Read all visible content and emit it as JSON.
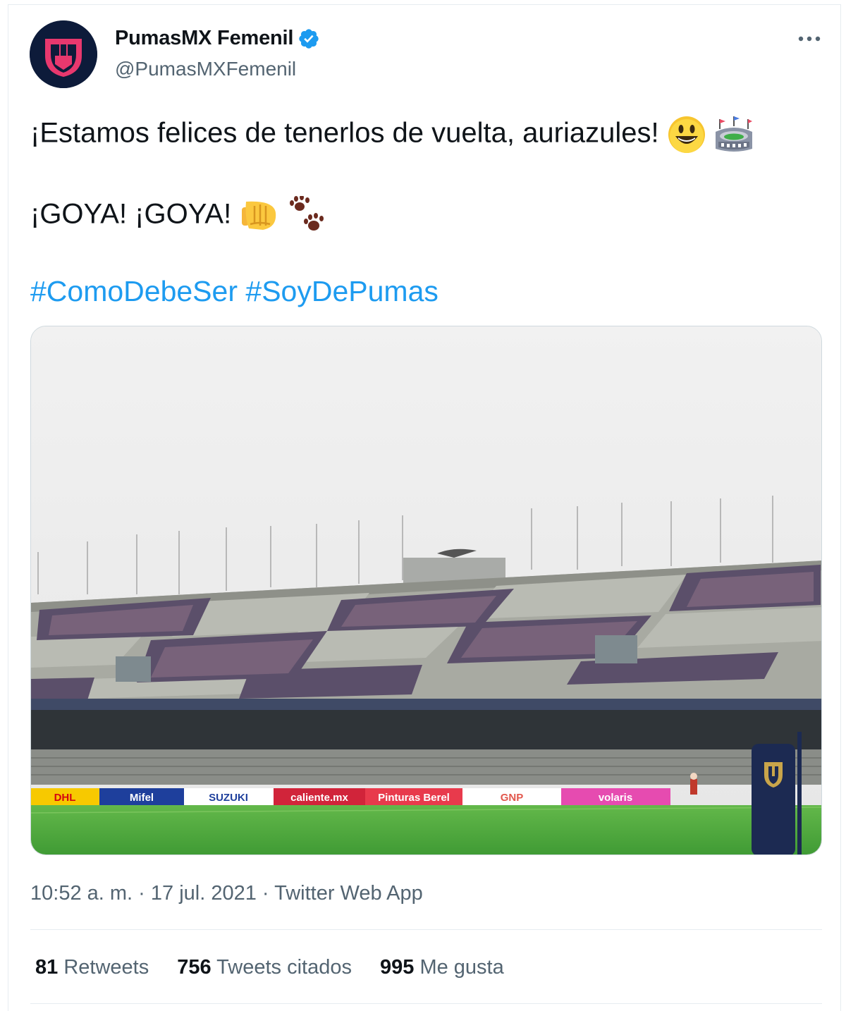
{
  "account": {
    "name": "PumasMX Femenil",
    "handle": "@PumasMXFemenil",
    "verified": true,
    "avatar_bg": "#0d1b3a",
    "avatar_accent": "#e8386e"
  },
  "tweet": {
    "line1": "¡Estamos felices de tenerlos de vuelta, auriazules!",
    "line1_emojis": [
      "smiley-face-emoji",
      "stadium-emoji"
    ],
    "line2": "¡GOYA! ¡GOYA!",
    "line2_emojis": [
      "fist-bump-emoji",
      "paw-prints-emoji"
    ],
    "hashtags": [
      "#ComoDebeSer",
      "#SoyDePumas"
    ]
  },
  "media": {
    "sponsor_boards": [
      "DHL",
      "Mifel",
      "SUZUKI",
      "caliente.mx",
      "Pinturas Berel",
      "GNP",
      "volaris"
    ]
  },
  "meta": {
    "time": "10:52 a. m.",
    "separator": " · ",
    "date": "17 jul. 2021",
    "source": "Twitter Web App"
  },
  "stats": {
    "retweets_count": "81",
    "retweets_label": "Retweets",
    "quotes_count": "756",
    "quotes_label": "Tweets citados",
    "likes_count": "995",
    "likes_label": "Me gusta"
  },
  "colors": {
    "link": "#1d9bf0",
    "text": "#0f1419",
    "secondary": "#536471",
    "verified": "#1d9bf0"
  }
}
